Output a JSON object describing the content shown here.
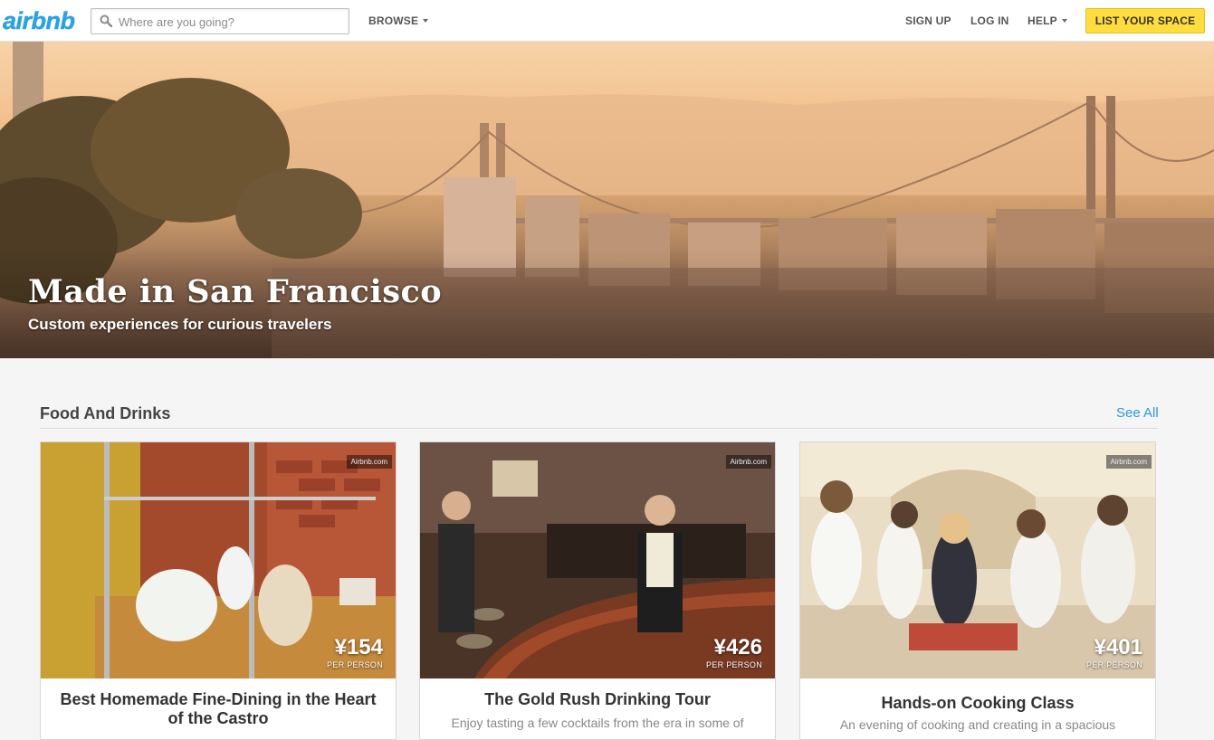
{
  "header": {
    "logo": "airbnb",
    "search_placeholder": "Where are you going?",
    "browse": "BROWSE",
    "sign_up": "SIGN UP",
    "log_in": "LOG IN",
    "help": "HELP",
    "list_space": "LIST YOUR SPACE"
  },
  "hero": {
    "title": "Made in San Francisco",
    "subtitle": "Custom experiences for curious travelers"
  },
  "section": {
    "title": "Food And Drinks",
    "see_all": "See All"
  },
  "cards": [
    {
      "watermark": "Airbnb.com",
      "price": "¥154",
      "per": "PER PERSON",
      "title": "Best Homemade Fine-Dining in the Heart of the Castro",
      "description": ""
    },
    {
      "watermark": "Airbnb.com",
      "price": "¥426",
      "per": "PER PERSON",
      "title": "The Gold Rush Drinking Tour",
      "description": "Enjoy tasting a few cocktails from the era in some of"
    },
    {
      "watermark": "Airbnb.com",
      "price": "¥401",
      "per": "PER PERSON",
      "title": "Hands-on Cooking Class",
      "description": "An evening of cooking and creating in a spacious"
    }
  ],
  "colors": {
    "brand_blue": "#2ea2e1",
    "cta_yellow": "#ffdd3f",
    "link_blue": "#2a9ae0"
  },
  "icons": {
    "search": "search-icon",
    "caret": "caret-down-icon"
  }
}
